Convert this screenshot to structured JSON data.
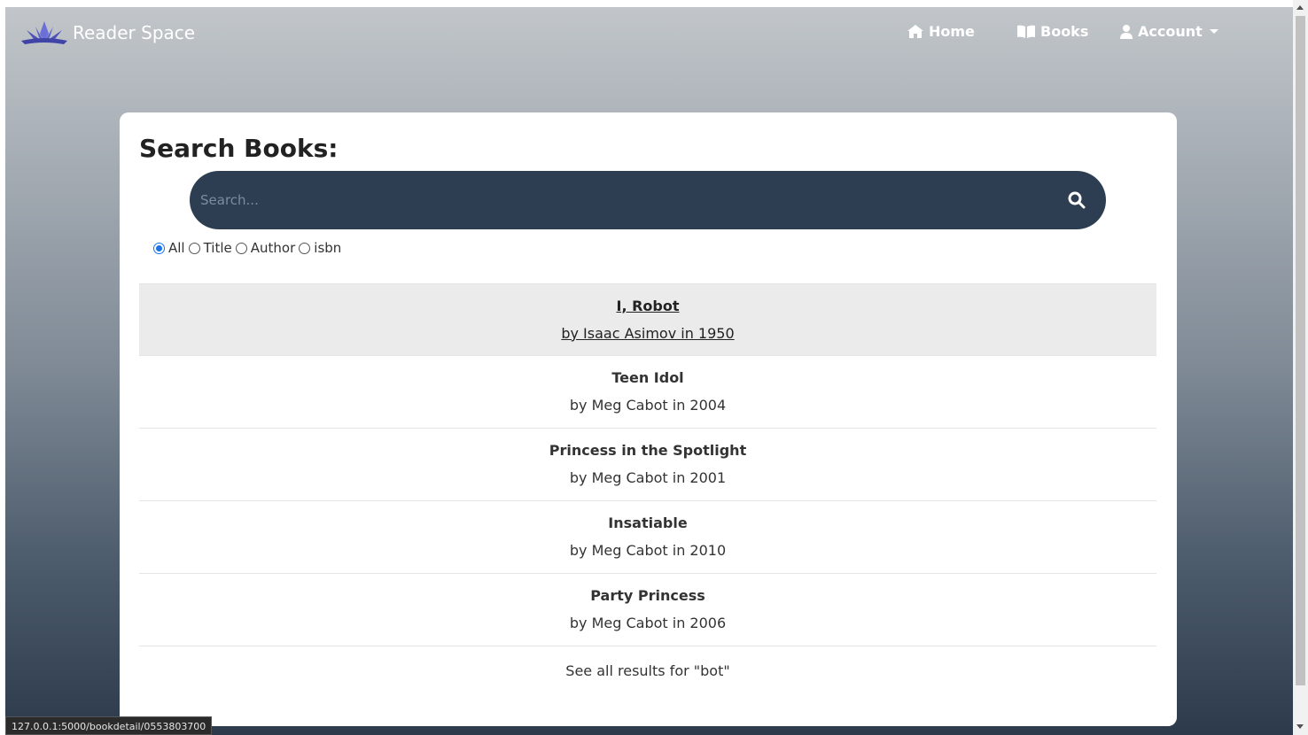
{
  "brand": {
    "name": "Reader Space"
  },
  "nav": {
    "home": "Home",
    "books": "Books",
    "account": "Account"
  },
  "search": {
    "title": "Search Books:",
    "placeholder": "Search...",
    "filters": [
      "All",
      "Title",
      "Author",
      "isbn"
    ],
    "selected_filter": "All"
  },
  "results": [
    {
      "title": "I, Robot",
      "byline": "by Isaac Asimov in 1950"
    },
    {
      "title": "Teen Idol",
      "byline": "by Meg Cabot in 2004"
    },
    {
      "title": "Princess in the Spotlight",
      "byline": "by Meg Cabot in 2001"
    },
    {
      "title": "Insatiable",
      "byline": "by Meg Cabot in 2010"
    },
    {
      "title": "Party Princess",
      "byline": "by Meg Cabot in 2006"
    }
  ],
  "see_all": "See all results for \"bot\"",
  "status_url": "127.0.0.1:5000/bookdetail/0553803700",
  "colors": {
    "searchbar": "#2e3e52",
    "radio_accent": "#1a73e8",
    "active_row": "#ebebeb"
  }
}
